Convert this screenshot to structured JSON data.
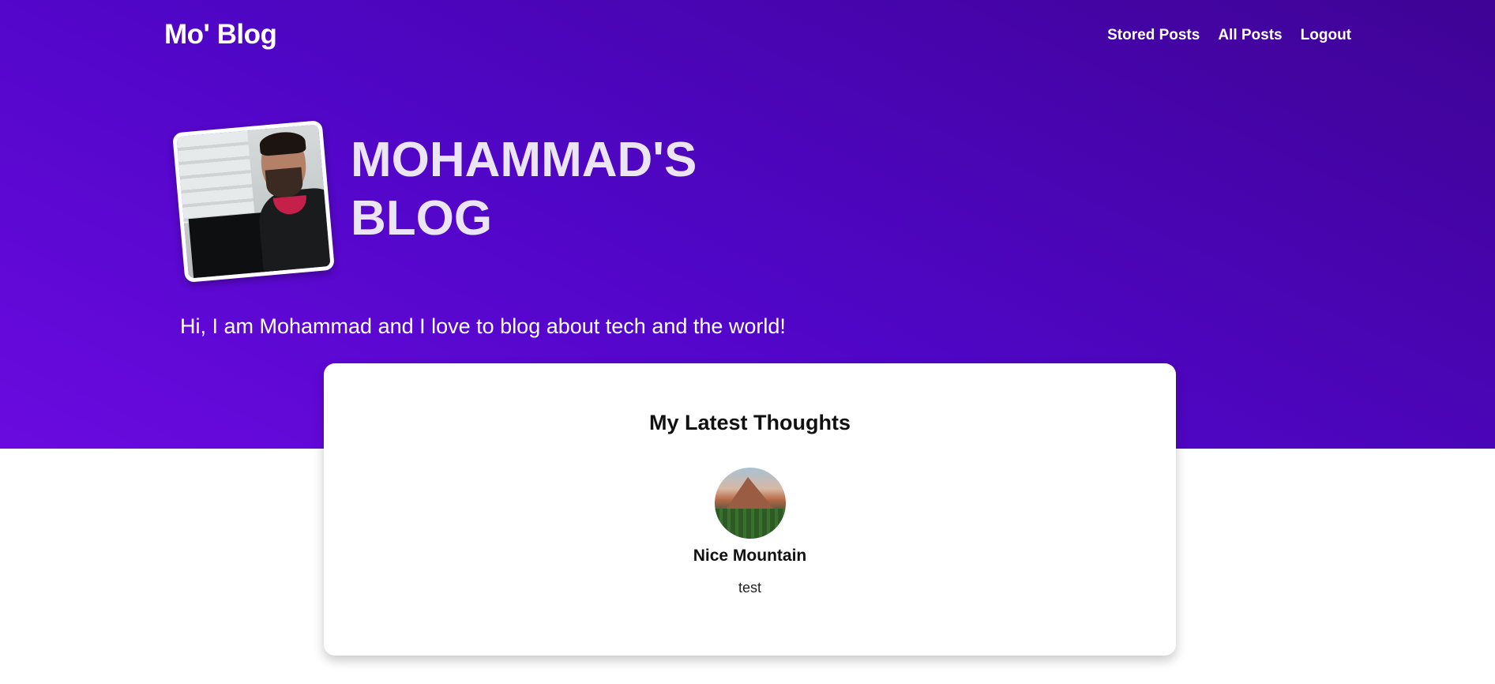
{
  "header": {
    "brand": "Mo' Blog",
    "nav": [
      "Stored Posts",
      "All Posts",
      "Logout"
    ]
  },
  "hero": {
    "title_line1": "MOHAMMAD'S",
    "title_line2": "BLOG",
    "subtitle": "Hi, I am Mohammad and I love to blog about tech and the world!"
  },
  "latest": {
    "heading": "My Latest Thoughts",
    "posts": [
      {
        "title": "Nice Mountain",
        "excerpt": "test"
      }
    ]
  },
  "colors": {
    "hero_gradient_start": "#6a0ae0",
    "hero_gradient_end": "#3f0395",
    "hero_title": "#ebe4f3"
  }
}
